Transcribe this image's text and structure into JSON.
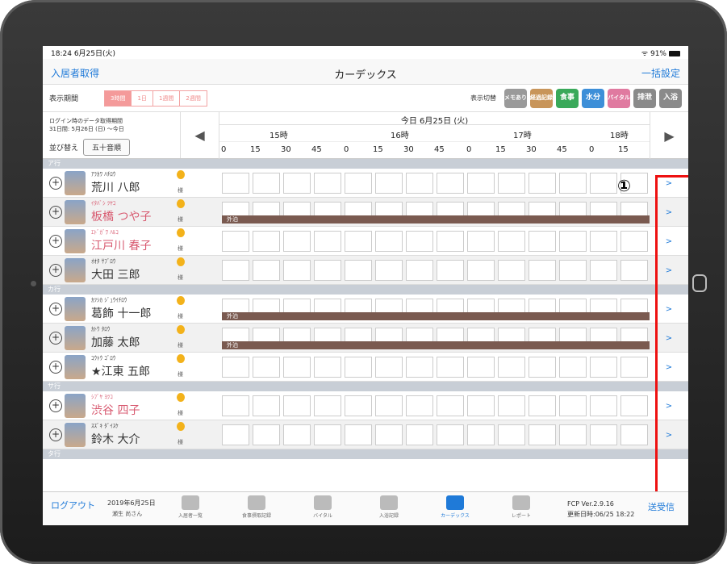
{
  "status": {
    "time": "18:24",
    "date": "6月25日(火)",
    "battery": "91%"
  },
  "nav": {
    "left": "入居者取得",
    "title": "カーデックス",
    "right": "一括設定"
  },
  "period": {
    "label": "表示期間",
    "buttons": [
      "3時間",
      "1日",
      "1週間",
      "2週間"
    ],
    "active": "3時間"
  },
  "toggles": {
    "label": "表示切替",
    "items": [
      {
        "label": "メモあり",
        "color": "#9a9a9a"
      },
      {
        "label": "経過記録",
        "color": "#c8955a"
      },
      {
        "label": "食事",
        "color": "#3aa95a"
      },
      {
        "label": "水分",
        "color": "#3d8fd8"
      },
      {
        "label": "バイタル",
        "color": "#e07aa0"
      },
      {
        "label": "排泄",
        "color": "#8a8a8a"
      },
      {
        "label": "入浴",
        "color": "#8a8a8a"
      }
    ]
  },
  "ctrl": {
    "login_label": "ログイン時のデータ取得期間",
    "login_range": "31日間: 5月26日 (日) 〜今日",
    "sort_label": "並び替え",
    "sort_value": "五十音順",
    "prev": "◀",
    "next": "▶",
    "today": "今日 6月25日 (火)",
    "hours": [
      "15時",
      "16時",
      "17時",
      "18時"
    ],
    "minutes": [
      "0",
      "15",
      "30",
      "45",
      "0",
      "15",
      "30",
      "45",
      "0",
      "15",
      "30",
      "45",
      "0",
      "15"
    ]
  },
  "sections": {
    "a": "ア行",
    "ka": "カ行",
    "sa": "サ行",
    "ta": "タ行"
  },
  "residents": [
    {
      "kana": "ｱﾗｶﾜ ﾊﾁﾛｳ",
      "name": "荒川 八郎",
      "sama": "様",
      "female": false
    },
    {
      "kana": "ｲﾀﾊﾞｼ ﾂﾔｺ",
      "name": "板橋 つや子",
      "sama": "様",
      "female": true,
      "bar": "外泊"
    },
    {
      "kana": "ｴﾄﾞｶﾞﾜ ﾊﾙｺ",
      "name": "江戸川 春子",
      "sama": "様",
      "female": true
    },
    {
      "kana": "ｵｵﾀ ｻﾌﾞﾛｳ",
      "name": "大田 三郎",
      "sama": "様",
      "female": false
    },
    {
      "kana": "ｶﾂｼｶ ｼﾞｭｳｲﾁﾛｳ",
      "name": "葛飾 十一郎",
      "sama": "様",
      "female": false,
      "bar": "外泊"
    },
    {
      "kana": "ｶﾄｳ ﾀﾛｳ",
      "name": "加藤 太郎",
      "sama": "様",
      "female": false,
      "bar": "外泊"
    },
    {
      "kana": "ｺｳﾄｳ ｺﾞﾛｳ",
      "name": "★江東 五郎",
      "sama": "様",
      "female": false
    },
    {
      "kana": "ｼﾌﾞﾔ ﾖﾂｺ",
      "name": "渋谷 四子",
      "sama": "様",
      "female": true
    },
    {
      "kana": "ｽｽﾞｷ ﾀﾞｲｽｹ",
      "name": "鈴木 大介",
      "sama": "様",
      "female": false
    }
  ],
  "go_label": ">",
  "marker": "①",
  "footer": {
    "logout": "ログアウト",
    "date": "2019年6月25日",
    "user": "瀬生 尚さん",
    "tabs": [
      "入居者一覧",
      "食事摂取記録",
      "バイタル",
      "入浴記録",
      "カーデックス",
      "レポート"
    ],
    "active_tab": "カーデックス",
    "version": "FCP Ver.2.9.16",
    "updated": "更新日時:06/25 18:22",
    "send": "送受信"
  }
}
